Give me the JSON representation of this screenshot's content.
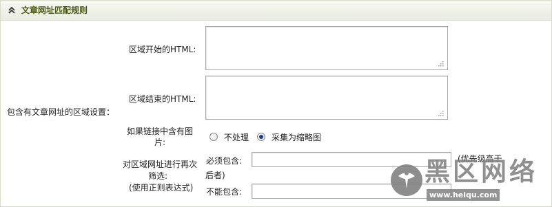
{
  "section": {
    "title": "文章网址匹配规则",
    "group_label": "包含有文章网址的区域设置："
  },
  "fields": {
    "area_start_label": "区域开始的HTML:",
    "area_end_label": "区域结束的HTML:",
    "image_label": "如果链接中含有图片:",
    "image_options": [
      {
        "label": "不处理",
        "checked": false
      },
      {
        "label": "采集为缩略图",
        "checked": true
      }
    ],
    "filter_label_line1": "对区域网址进行再次",
    "filter_label_line2": "筛选:",
    "filter_label_line3": "(使用正则表达式)",
    "must_include_label": "必须包含:",
    "priority_note_line1": "(优先级高于",
    "priority_note_line2": "后者)",
    "cannot_include_label": "不能包含:",
    "must_include_value": "",
    "cannot_include_value": ""
  },
  "watermark": {
    "logo_icon": "heiqu-logo-icon",
    "text": "黑区网络",
    "url": "www.heiqu.com"
  }
}
